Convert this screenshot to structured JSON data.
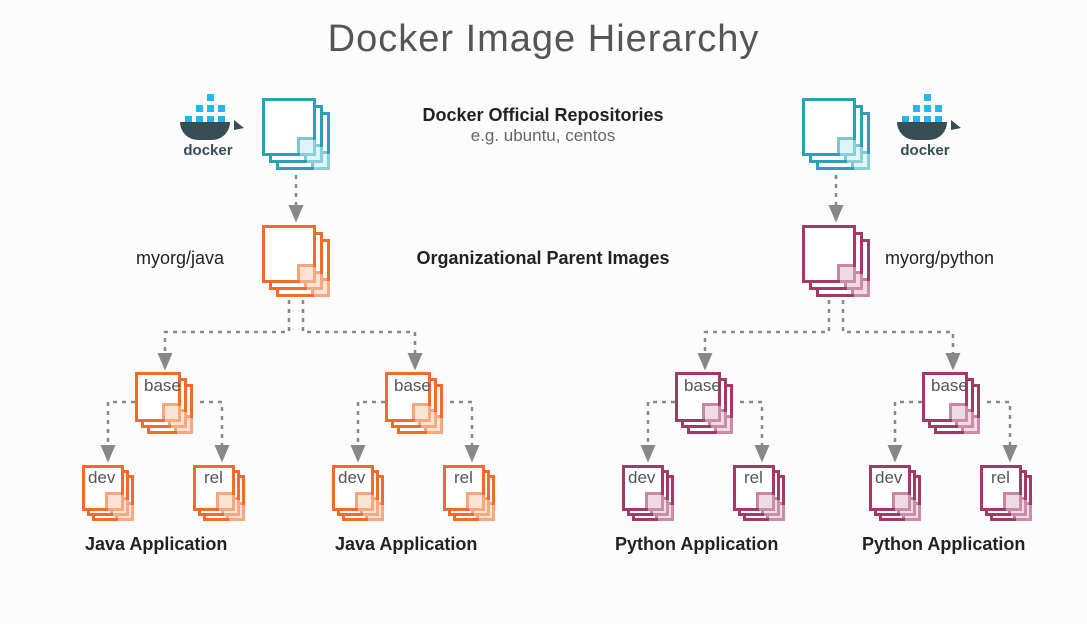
{
  "title": "Docker Image Hierarchy",
  "layers": {
    "official": {
      "title": "Docker Official Repositories",
      "subtitle": "e.g. ubuntu, centos"
    },
    "org": {
      "title": "Organizational Parent Images",
      "left_label": "myorg/java",
      "right_label": "myorg/python"
    }
  },
  "labels": {
    "base": "base",
    "dev": "dev",
    "rel": "rel"
  },
  "apps": {
    "java": "Java Application",
    "python": "Python Application"
  },
  "docker_brand": "docker"
}
